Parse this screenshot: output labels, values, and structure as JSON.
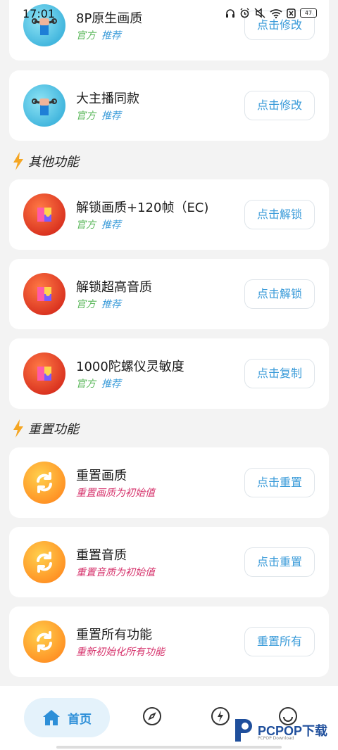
{
  "status_bar": {
    "time": "17:01",
    "battery": "47"
  },
  "sections": {
    "other": "其他功能",
    "reset": "重置功能"
  },
  "cards": [
    {
      "title": "8P原生画质",
      "tag1": "官方",
      "tag2": "推荐",
      "button": "点击修改"
    },
    {
      "title": "大主播同款",
      "tag1": "官方",
      "tag2": "推荐",
      "button": "点击修改"
    },
    {
      "title": "解锁画质+120帧（EC)",
      "tag1": "官方",
      "tag2": "推荐",
      "button": "点击解锁"
    },
    {
      "title": "解锁超高音质",
      "tag1": "官方",
      "tag2": "推荐",
      "button": "点击解锁"
    },
    {
      "title": "1000陀螺仪灵敏度",
      "tag1": "官方",
      "tag2": "推荐",
      "button": "点击复制"
    },
    {
      "title": "重置画质",
      "desc": "重置画质为初始值",
      "button": "点击重置"
    },
    {
      "title": "重置音质",
      "desc": "重置音质为初始值",
      "button": "点击重置"
    },
    {
      "title": "重置所有功能",
      "desc": "重新初始化所有功能",
      "button": "重置所有"
    }
  ],
  "bottom_nav": {
    "home_label": "首页"
  },
  "watermark": {
    "text": "PCPOP下载",
    "sub": "PCPOP Download"
  },
  "colors": {
    "accent": "#3a9bd9",
    "official": "#5cb85c",
    "reset_desc": "#d6336c",
    "nav_home_bg": "#e4f2fb"
  }
}
